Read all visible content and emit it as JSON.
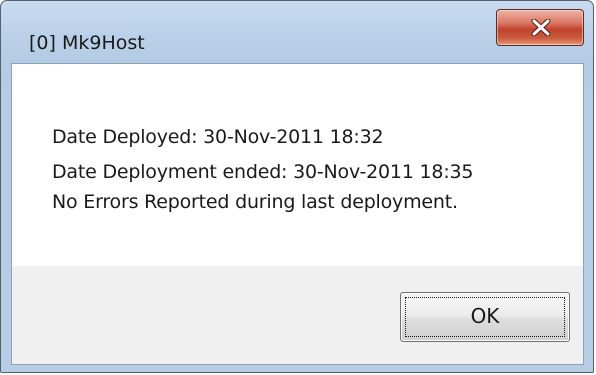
{
  "window": {
    "title": "[0] Mk9Host"
  },
  "message": {
    "lines": [
      "Date Deployed: 30-Nov-2011 18:32",
      "Date Deployment ended: 30-Nov-2011 18:35",
      "No Errors Reported during last deployment."
    ]
  },
  "buttons": {
    "ok_label": "OK",
    "close_icon": "close-x-icon"
  },
  "colors": {
    "close_button": "#c2432d",
    "frame": "#b4cbe5",
    "content_bg": "#f0f0f0"
  }
}
